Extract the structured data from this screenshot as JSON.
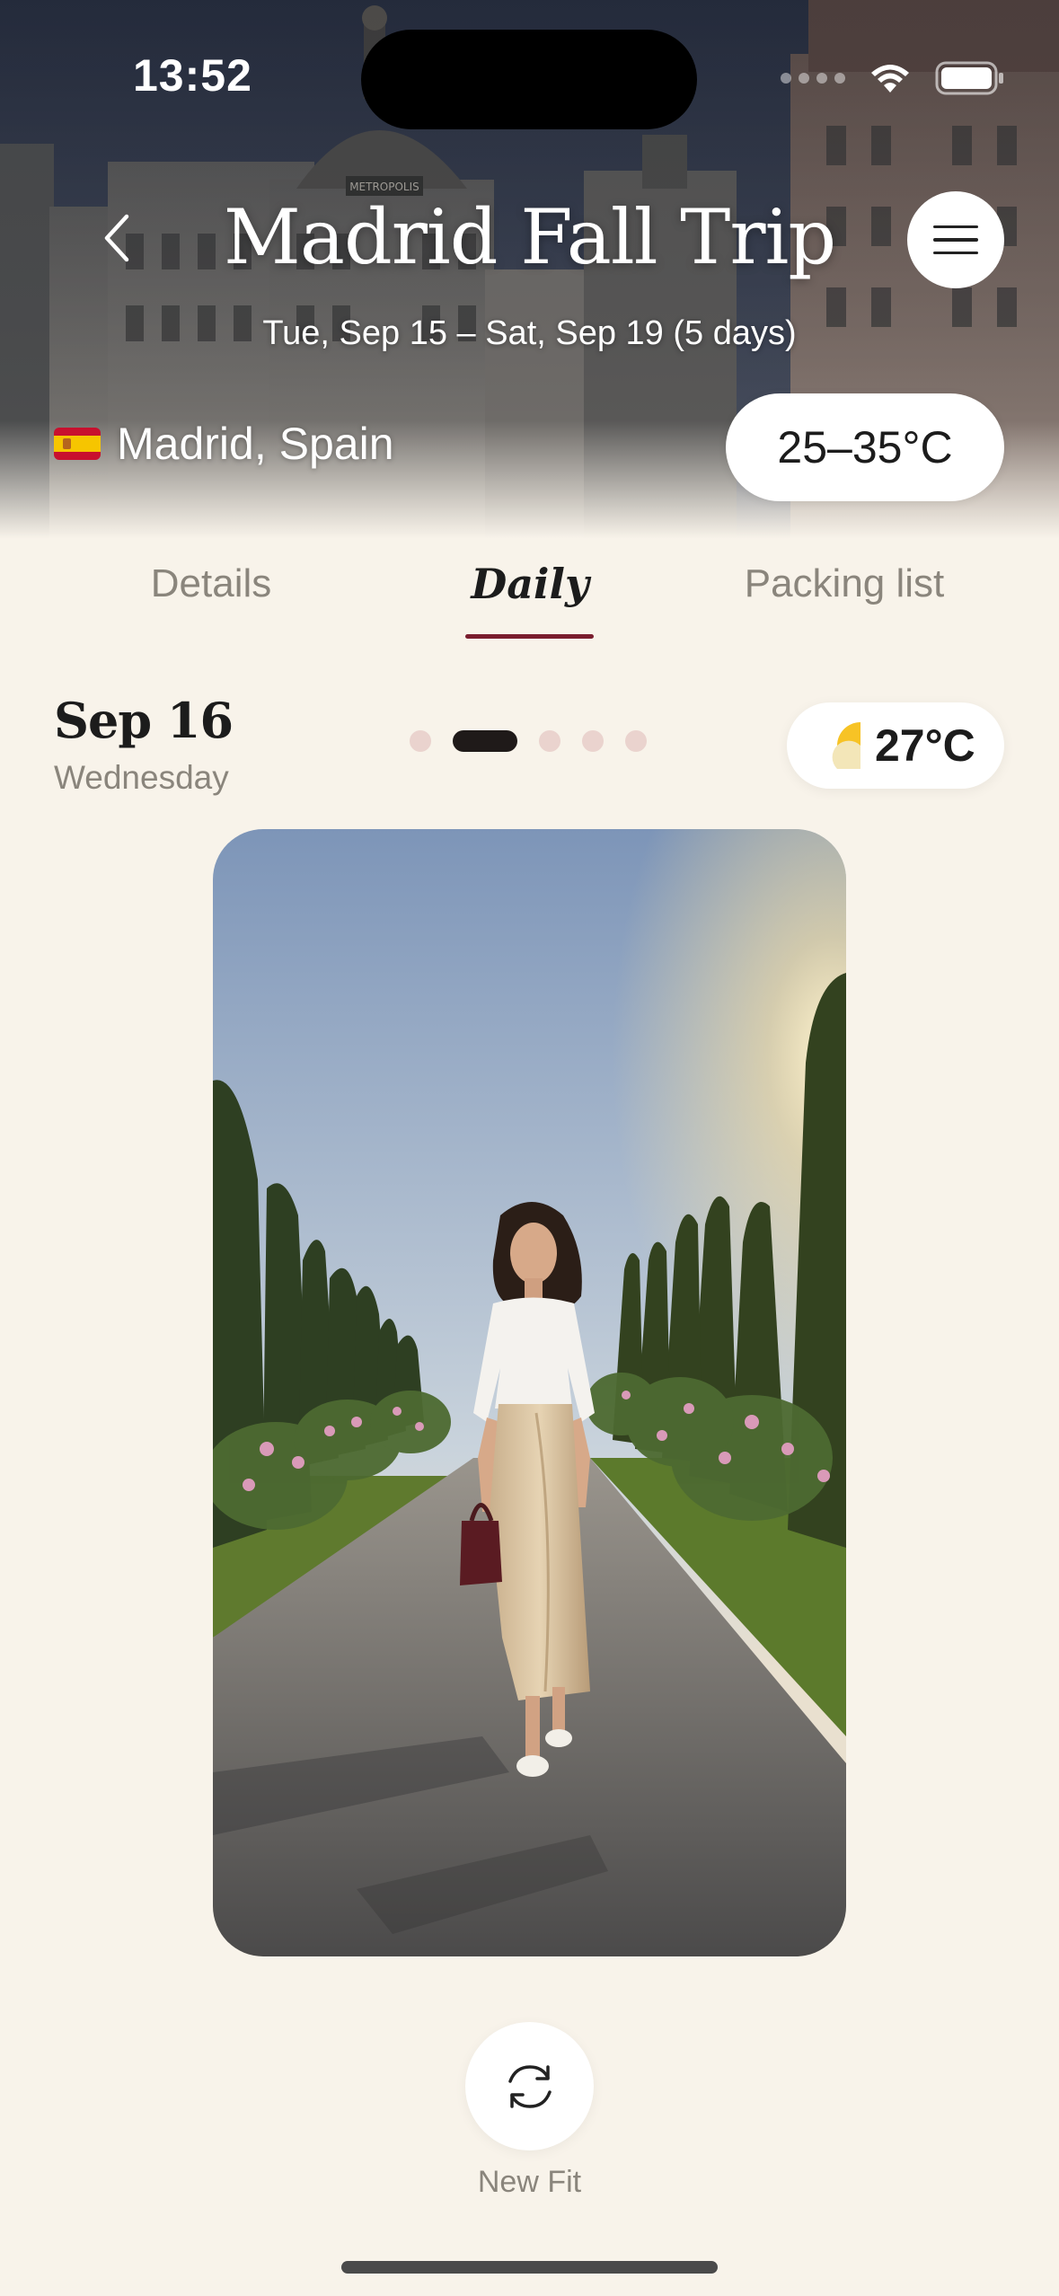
{
  "status_bar": {
    "time": "13:52"
  },
  "header": {
    "title": "Madrid Fall Trip",
    "dates": "Tue, Sep 15 – Sat, Sep 19 (5 days)",
    "location": "Madrid, Spain",
    "temperature_range": "25–35°C",
    "building_sign": "METROPOLIS"
  },
  "tabs": [
    {
      "label": "Details",
      "active": false
    },
    {
      "label": "Daily",
      "active": true
    },
    {
      "label": "Packing list",
      "active": false
    }
  ],
  "day": {
    "date": "Sep 16",
    "weekday": "Wednesday",
    "page_index": 1,
    "page_count": 5,
    "weather_icon": "partly-sunny-icon",
    "temperature": "27°C"
  },
  "actions": {
    "new_fit_label": "New Fit"
  },
  "colors": {
    "accent": "#7a1d2e",
    "background": "#f8f3ea",
    "inactive_dot": "#ead3ce"
  }
}
